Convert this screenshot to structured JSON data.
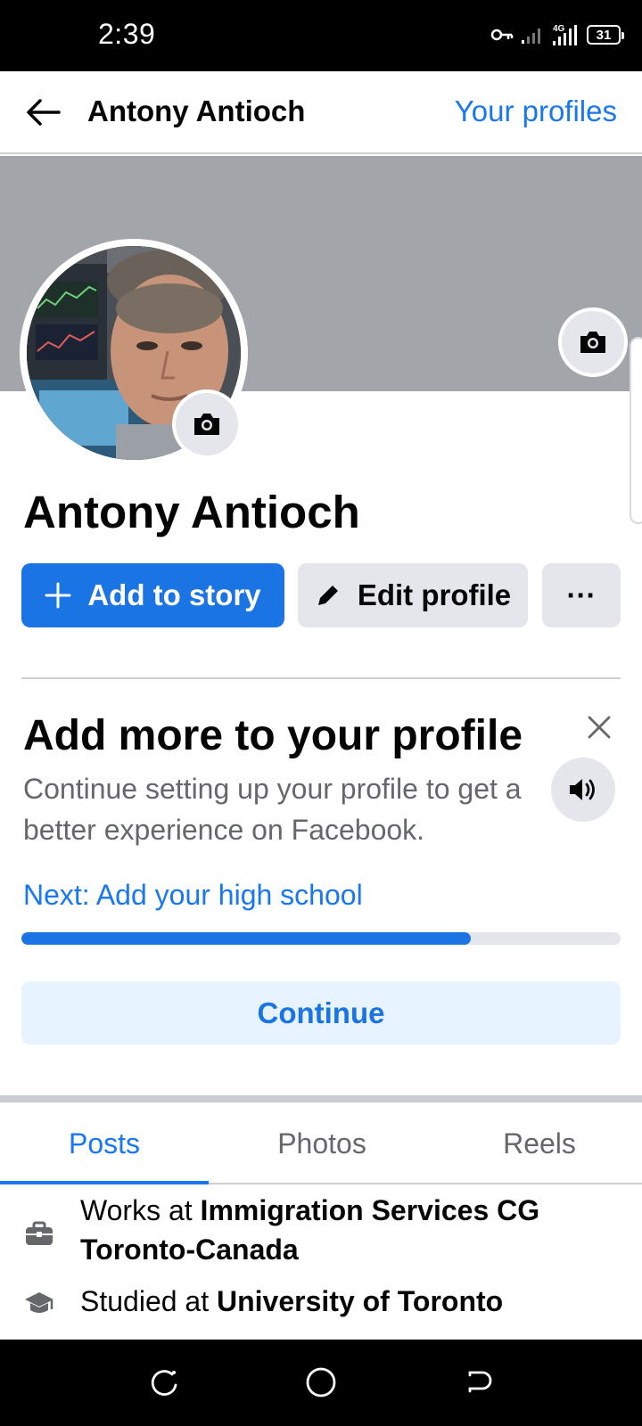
{
  "status_bar": {
    "time": "2:39",
    "network": "4G",
    "battery": "31"
  },
  "top_nav": {
    "title": "Antony Antioch",
    "link_label": "Your profiles"
  },
  "profile": {
    "name": "Antony Antioch"
  },
  "actions": {
    "add_story": "Add to story",
    "edit_profile": "Edit profile",
    "more": "···"
  },
  "card": {
    "title": "Add more to your profile",
    "description": "Continue setting up your profile to get a better experience on Facebook.",
    "next": "Next: Add your high school",
    "progress": 0.75,
    "continue_label": "Continue"
  },
  "tabs": [
    {
      "label": "Posts",
      "active": true
    },
    {
      "label": "Photos",
      "active": false
    },
    {
      "label": "Reels",
      "active": false
    }
  ],
  "details": {
    "work_prefix": "Works at ",
    "work_place": "Immigration Services CG Toronto-Canada",
    "study_prefix": "Studied at ",
    "study_place": "University of Toronto"
  },
  "icons": {
    "back": "arrow-left-icon",
    "camera": "camera-icon",
    "plus": "plus-icon",
    "pencil": "pencil-icon",
    "close": "close-icon",
    "audio": "speaker-icon",
    "work": "briefcase-icon",
    "study": "graduation-cap-icon"
  },
  "colors": {
    "accent": "#1877f2",
    "button_primary": "#1b74e4",
    "button_secondary": "#e4e6eb",
    "cover": "#a2a5aa"
  }
}
